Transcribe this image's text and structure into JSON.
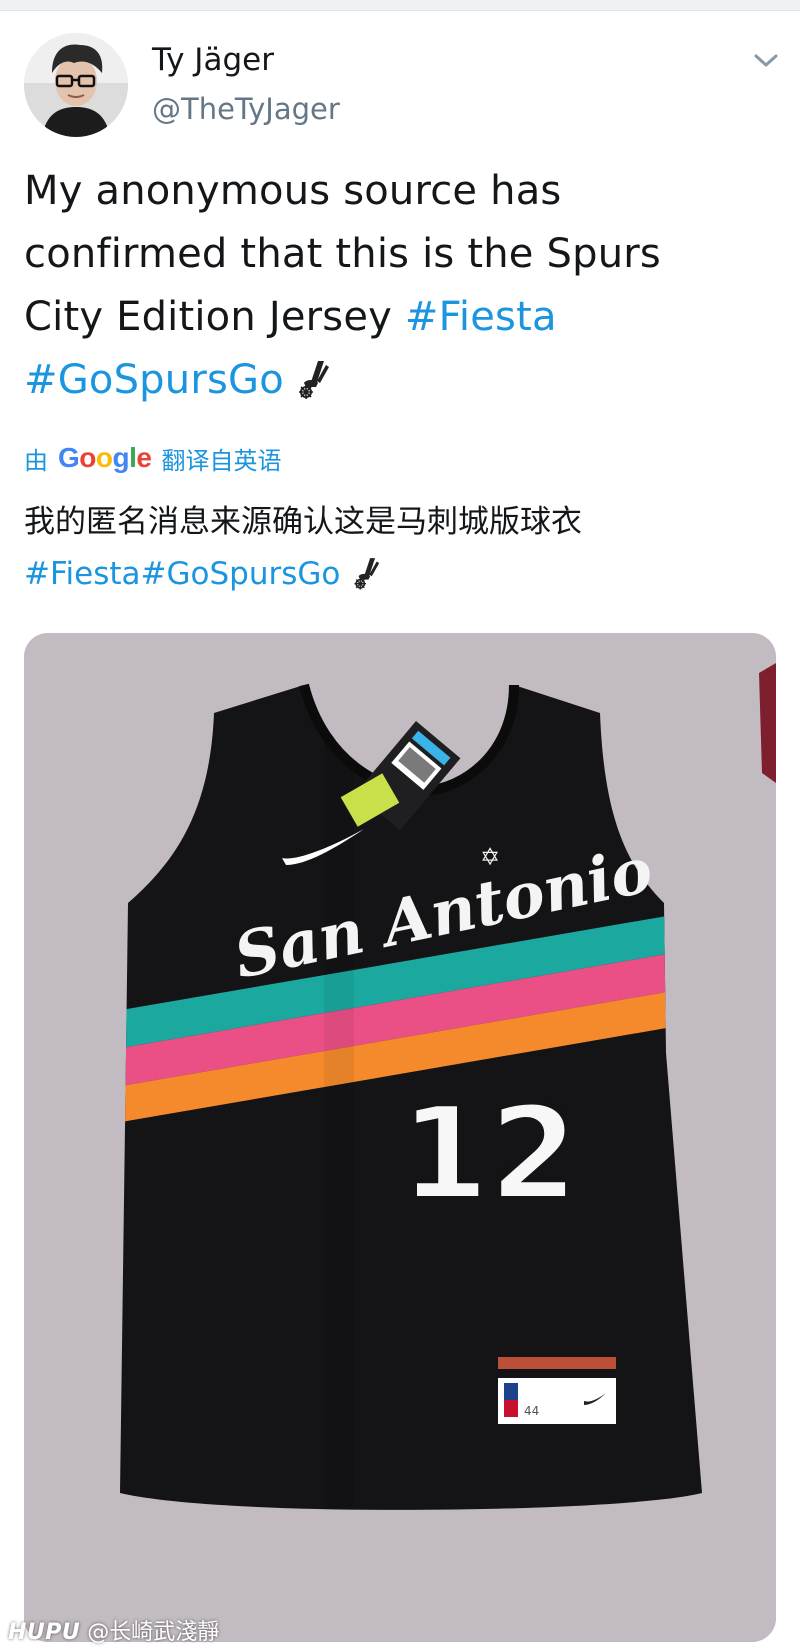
{
  "tweet": {
    "author": {
      "display_name": "Ty Jäger",
      "handle": "@TheTyJager",
      "avatar_icon": "person-with-glasses-avatar"
    },
    "menu_icon": "chevron-down-icon",
    "text_lines": [
      "My anonymous source has",
      "confirmed that this is the Spurs",
      "City Edition Jersey "
    ],
    "hashtags": [
      "#Fiesta",
      "#GoSpursGo"
    ],
    "emoji_icon": "spurs-logo-icon",
    "translation": {
      "prefix": "由",
      "provider": "Google",
      "suffix": "翻译自英语",
      "text": "我的匿名消息来源确认这是马刺城版球衣",
      "hashtags_line": "#Fiesta#GoSpursGo"
    }
  },
  "photo": {
    "description_icon": "basketball-jersey-photo",
    "wordmark": "San Antonio",
    "number": "12",
    "tag_size": "44"
  },
  "watermark": {
    "brand": "HUPU",
    "user": "@长崎武淺靜"
  },
  "colors": {
    "link": "#1b95e0",
    "text": "#14171a",
    "secondary": "#657786",
    "stripe_teal": "#1ba89f",
    "stripe_pink": "#ea4f86",
    "stripe_orange": "#f48a2c",
    "jersey_black": "#141416"
  }
}
